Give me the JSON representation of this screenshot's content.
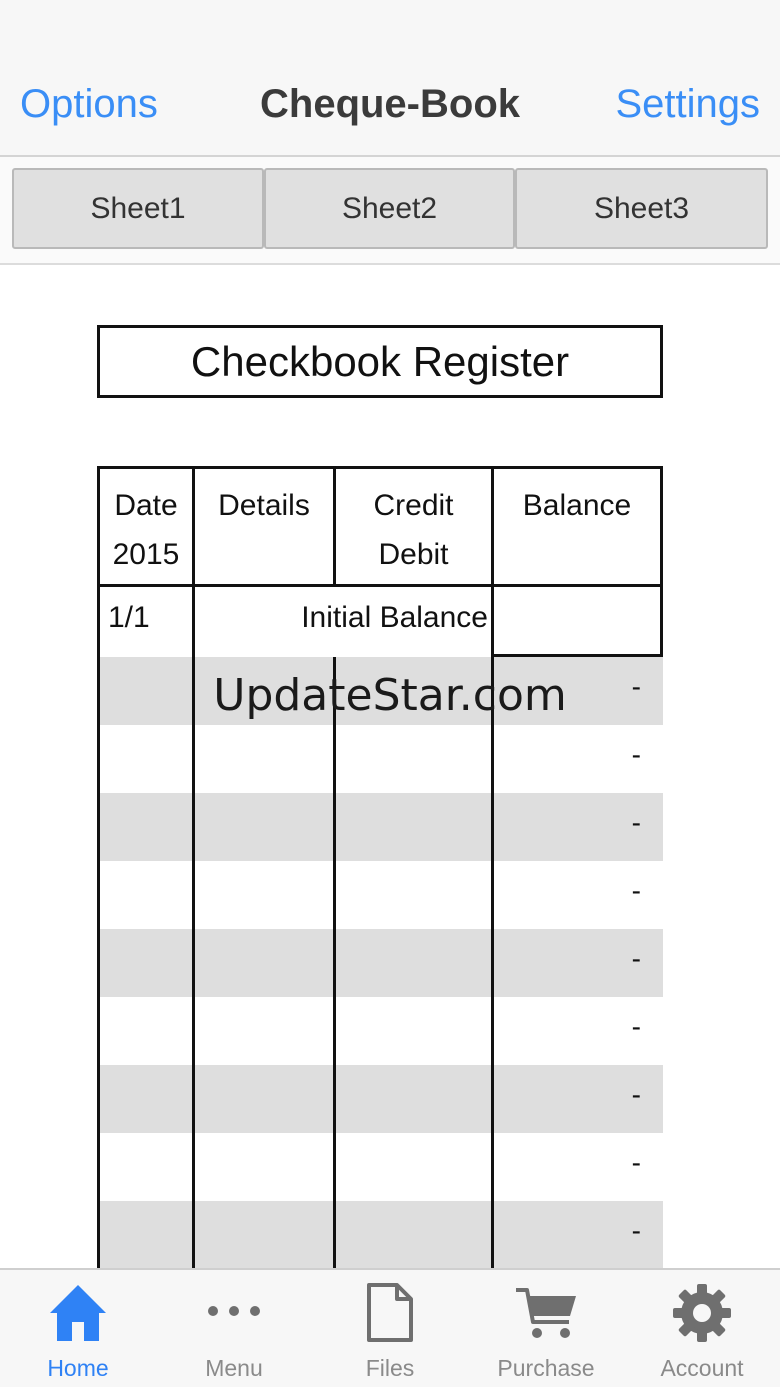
{
  "nav": {
    "left": "Options",
    "title": "Cheque-Book",
    "right": "Settings"
  },
  "sheets": [
    {
      "label": "Sheet1"
    },
    {
      "label": "Sheet2"
    },
    {
      "label": "Sheet3"
    }
  ],
  "register": {
    "title": "Checkbook Register",
    "headers": {
      "date_line1": "Date",
      "date_line2": "2015",
      "details": "Details",
      "credit_line1": "Credit",
      "credit_line2": "Debit",
      "balance": "Balance"
    },
    "initial_row": {
      "date": "1/1",
      "label": "Initial Balance",
      "balance": ""
    },
    "rows": [
      {
        "balance": "-"
      },
      {
        "balance": "-"
      },
      {
        "balance": "-"
      },
      {
        "balance": "-"
      },
      {
        "balance": "-"
      },
      {
        "balance": "-"
      },
      {
        "balance": "-"
      },
      {
        "balance": "-"
      },
      {
        "balance": "-"
      }
    ]
  },
  "watermark": "UpdateStar.com",
  "tabbar": {
    "home": "Home",
    "menu": "Menu",
    "files": "Files",
    "purchase": "Purchase",
    "account": "Account"
  },
  "colors": {
    "accent": "#3a8ef6",
    "row_shade": "#dedede",
    "button_bg": "#e0e0e0"
  }
}
